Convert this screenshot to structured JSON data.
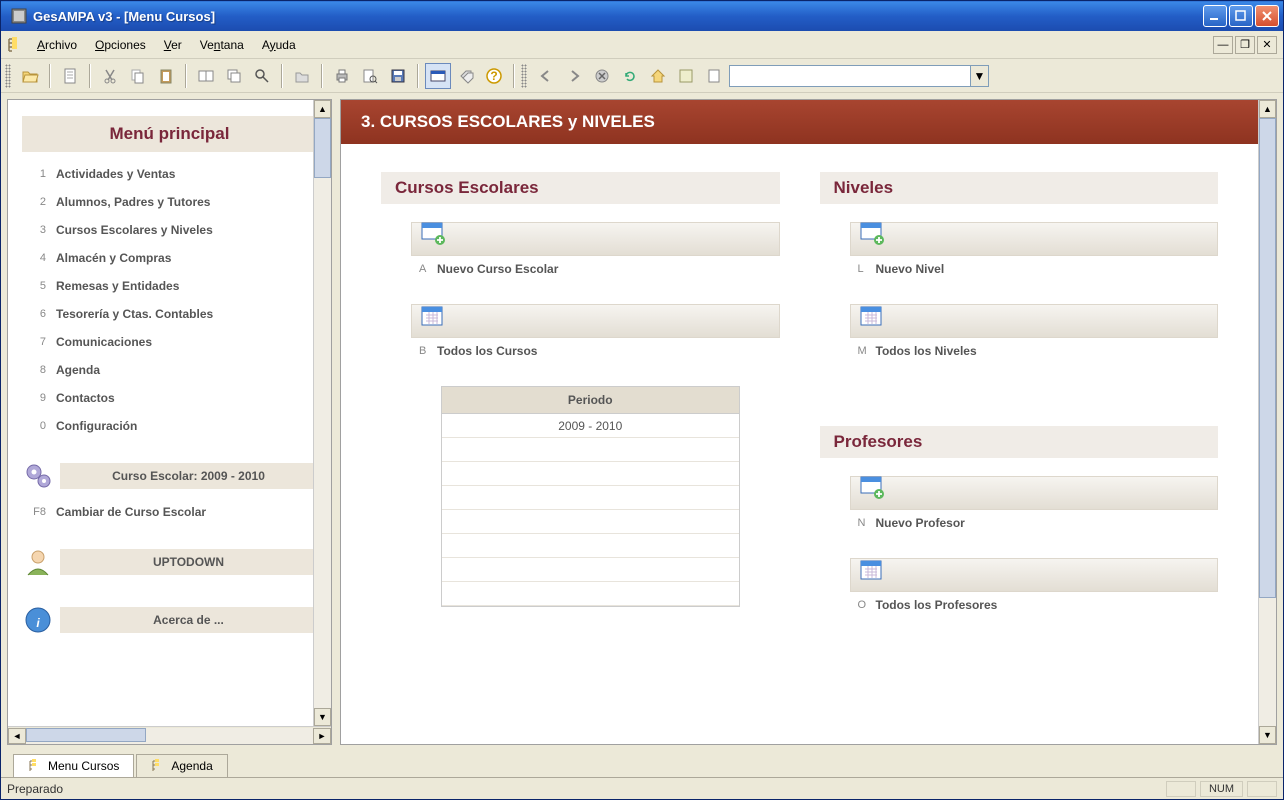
{
  "window": {
    "title": "GesAMPA v3 - [Menu Cursos]"
  },
  "menubar": {
    "items": [
      {
        "label": "Archivo",
        "u": "A"
      },
      {
        "label": "Opciones",
        "u": "O"
      },
      {
        "label": "Ver",
        "u": "V"
      },
      {
        "label": "Ventana",
        "u": "V"
      },
      {
        "label": "Ayuda",
        "u": "A"
      }
    ]
  },
  "toolbar": {
    "search_value": ""
  },
  "sidebar": {
    "title": "Menú principal",
    "items": [
      {
        "num": "1",
        "label": "Actividades y Ventas"
      },
      {
        "num": "2",
        "label": "Alumnos, Padres y Tutores"
      },
      {
        "num": "3",
        "label": "Cursos Escolares y Niveles"
      },
      {
        "num": "4",
        "label": "Almacén y Compras"
      },
      {
        "num": "5",
        "label": "Remesas y Entidades"
      },
      {
        "num": "6",
        "label": "Tesorería y Ctas. Contables"
      },
      {
        "num": "7",
        "label": "Comunicaciones"
      },
      {
        "num": "8",
        "label": "Agenda"
      },
      {
        "num": "9",
        "label": "Contactos"
      },
      {
        "num": "0",
        "label": "Configuración"
      }
    ],
    "course_info": "Curso Escolar: 2009 - 2010",
    "change_course_key": "F8",
    "change_course": "Cambiar de Curso Escolar",
    "user": "UPTODOWN",
    "about": "Acerca de ..."
  },
  "main": {
    "header": "3.  CURSOS ESCOLARES y NIVELES",
    "sections": {
      "cursos": {
        "title": "Cursos Escolares",
        "actions": [
          {
            "key": "A",
            "label": "Nuevo Curso Escolar",
            "icon": "new"
          },
          {
            "key": "B",
            "label": "Todos los Cursos",
            "icon": "list"
          }
        ],
        "period": {
          "title": "Periodo",
          "rows": [
            "2009 - 2010",
            "",
            "",
            "",
            "",
            "",
            "",
            ""
          ]
        }
      },
      "niveles": {
        "title": "Niveles",
        "actions": [
          {
            "key": "L",
            "label": "Nuevo Nivel",
            "icon": "new"
          },
          {
            "key": "M",
            "label": "Todos los Niveles",
            "icon": "list"
          }
        ]
      },
      "profesores": {
        "title": "Profesores",
        "actions": [
          {
            "key": "N",
            "label": "Nuevo Profesor",
            "icon": "new"
          },
          {
            "key": "O",
            "label": "Todos los Profesores",
            "icon": "list"
          }
        ]
      }
    }
  },
  "tabs": [
    {
      "label": "Menu Cursos",
      "active": true
    },
    {
      "label": "Agenda",
      "active": false
    }
  ],
  "statusbar": {
    "text": "Preparado",
    "num": "NUM"
  }
}
